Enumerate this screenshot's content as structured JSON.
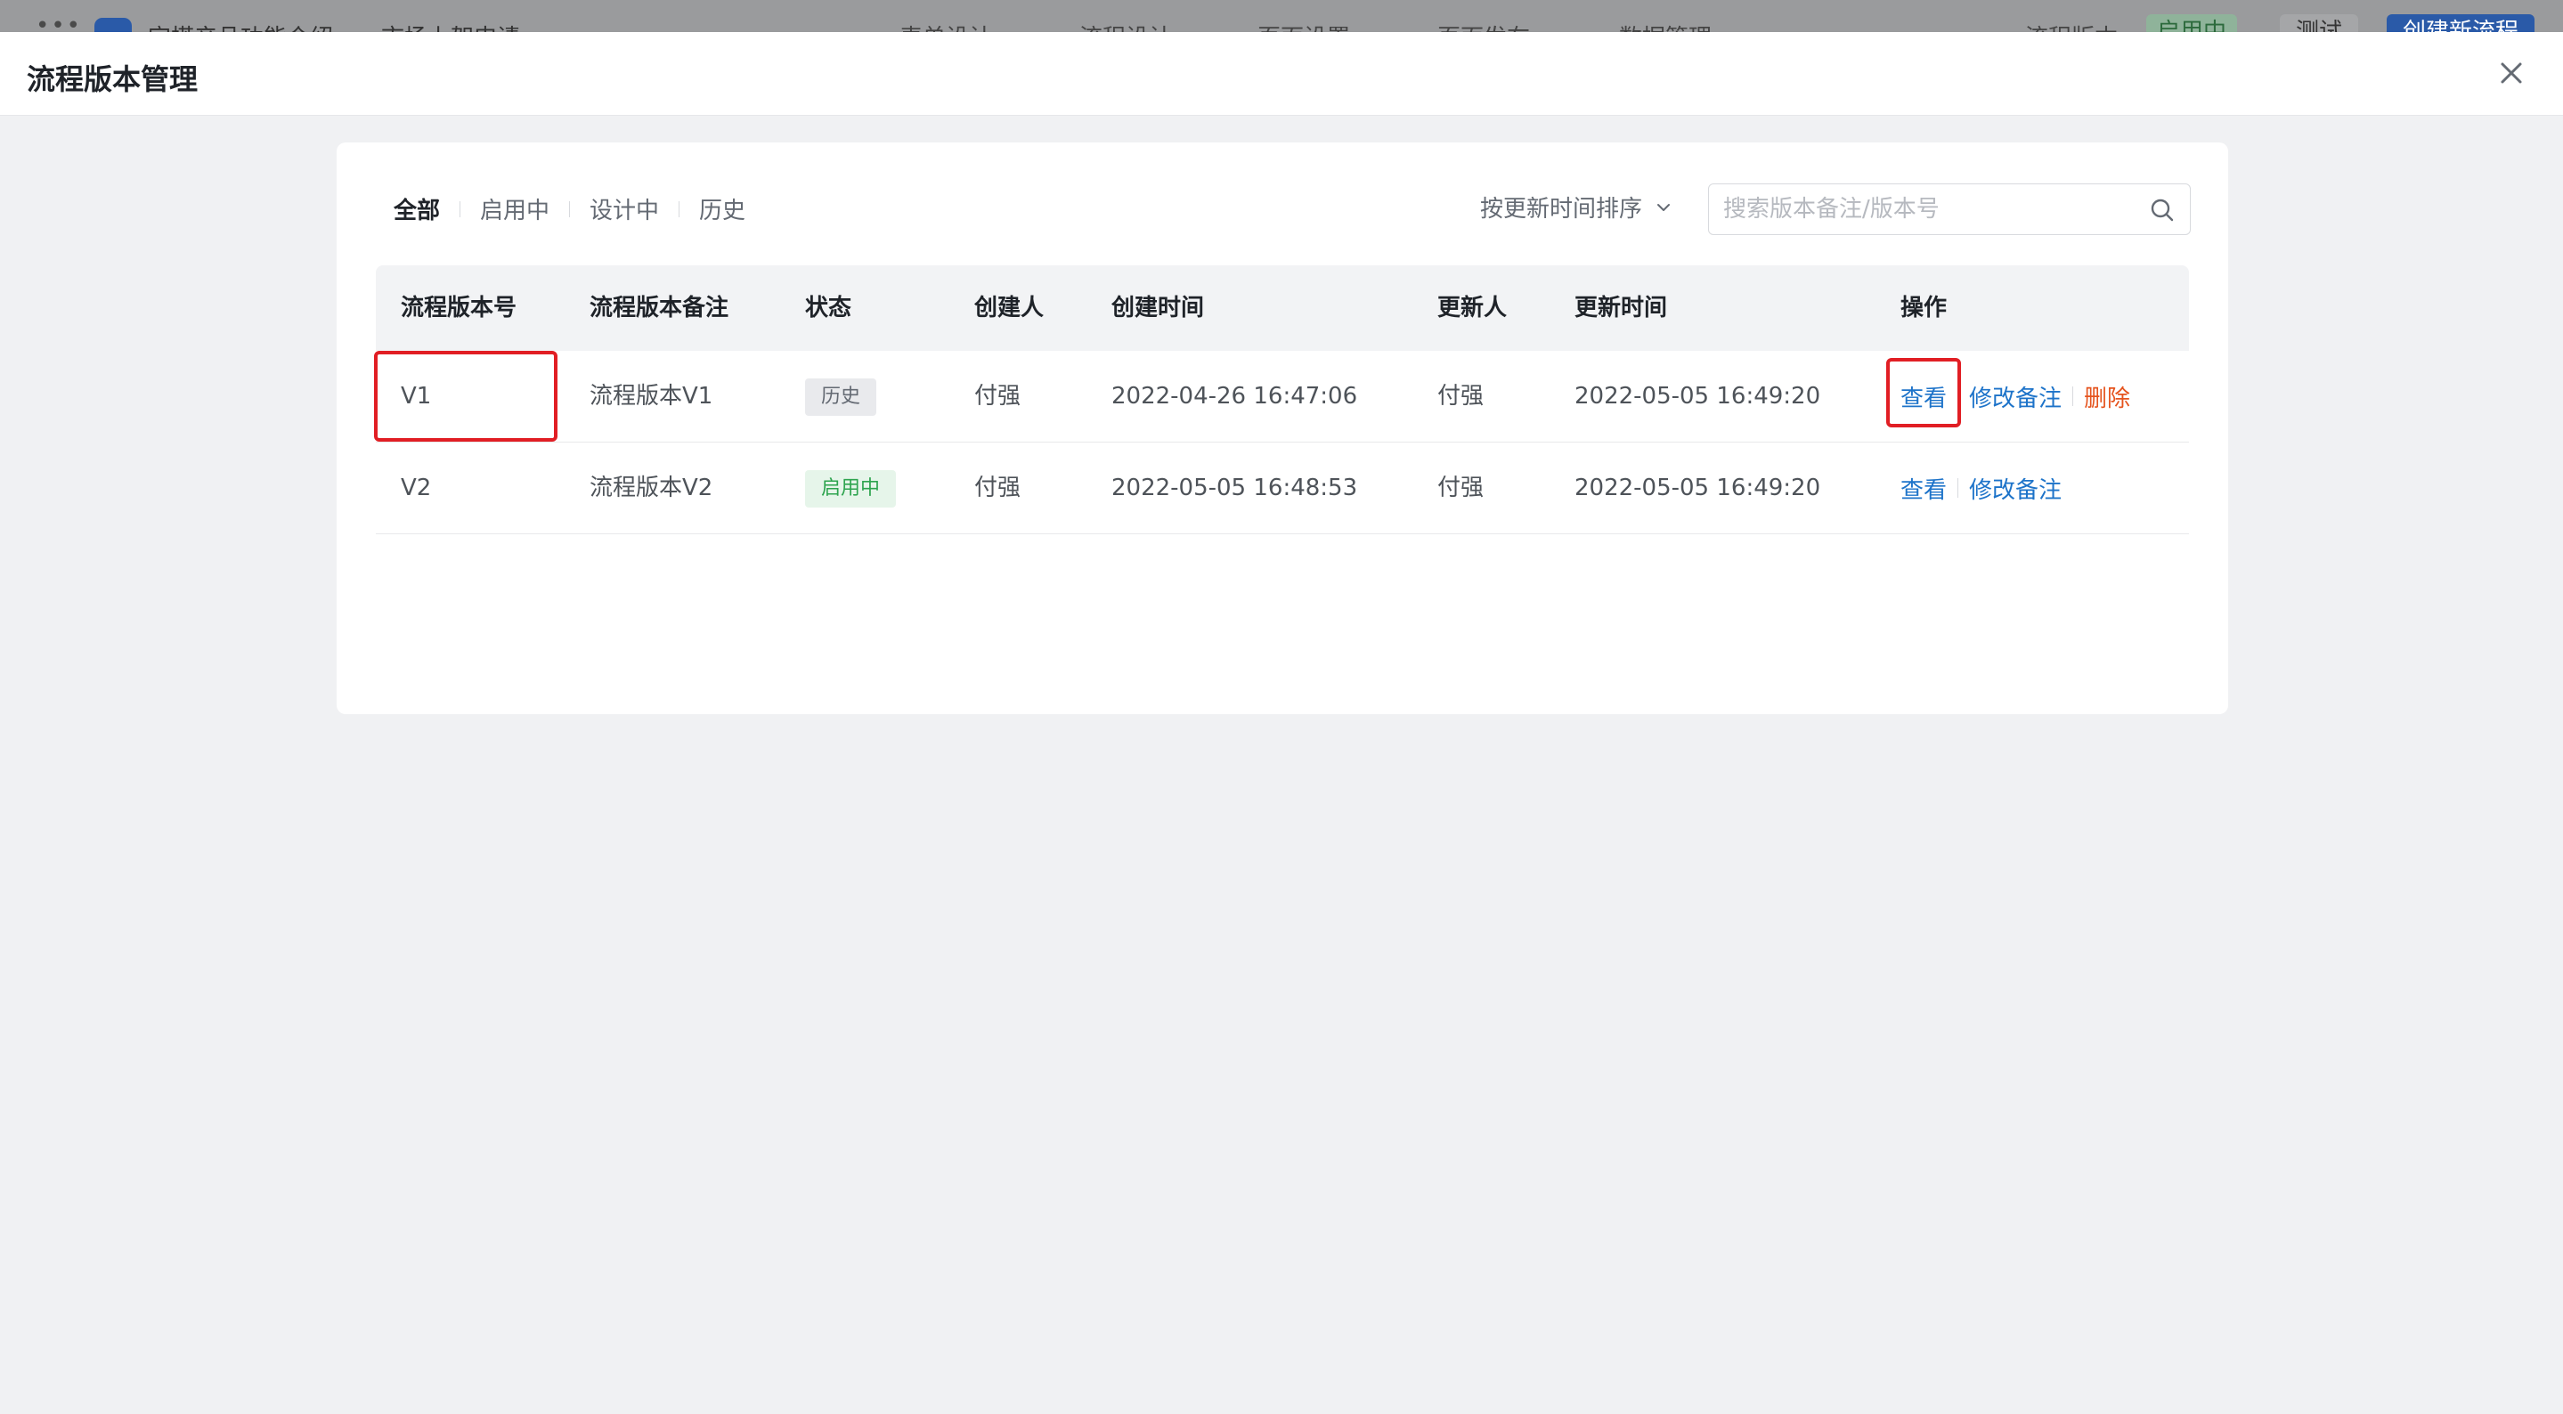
{
  "topbar": {
    "app_name": "宜搭产品功能介绍",
    "form_name": "市场上架申请",
    "nav": [
      "表单设计",
      "流程设计",
      "页面设置",
      "页面发布",
      "数据管理"
    ],
    "version_label": "流程版本",
    "version_status": "启用中",
    "test_label": "测试",
    "create_label": "创建新流程"
  },
  "modal": {
    "title": "流程版本管理"
  },
  "filters": {
    "tabs": [
      "全部",
      "启用中",
      "设计中",
      "历史"
    ],
    "active_tab": "全部",
    "sort_label": "按更新时间排序",
    "search_placeholder": "搜索版本备注/版本号"
  },
  "table": {
    "columns": [
      "流程版本号",
      "流程版本备注",
      "状态",
      "创建人",
      "创建时间",
      "更新人",
      "更新时间",
      "操作"
    ],
    "rows": [
      {
        "version": "V1",
        "note": "流程版本V1",
        "status": "历史",
        "creator": "付强",
        "created_at": "2022-04-26 16:47:06",
        "updater": "付强",
        "updated_at": "2022-05-05 16:49:20",
        "actions": [
          "查看",
          "修改备注",
          "删除"
        ]
      },
      {
        "version": "V2",
        "note": "流程版本V2",
        "status": "启用中",
        "creator": "付强",
        "created_at": "2022-05-05 16:48:53",
        "updater": "付强",
        "updated_at": "2022-05-05 16:49:20",
        "actions": [
          "查看",
          "修改备注"
        ]
      }
    ]
  },
  "colors": {
    "link": "#1d73c9",
    "danger": "#e5531d",
    "highlight": "#e11e24",
    "active_badge": "#2ea44f"
  }
}
